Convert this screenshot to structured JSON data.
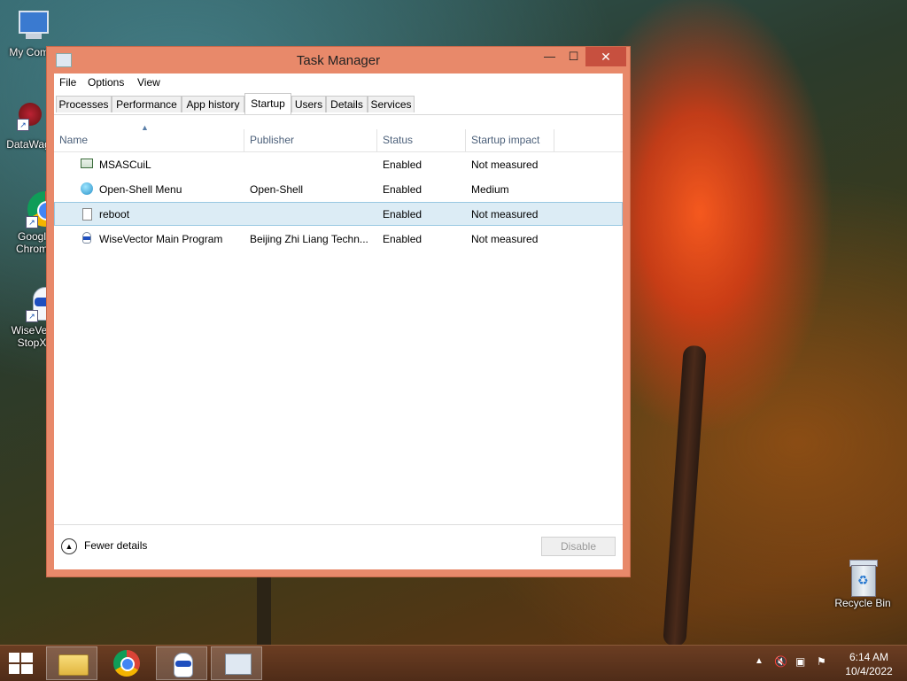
{
  "desktop": {
    "icons": [
      {
        "label": "My Comp",
        "icon": "computer-icon"
      },
      {
        "label": "DataWag",
        "icon": "datawag-icon"
      },
      {
        "label": "Googl",
        "label2": "Chrom",
        "icon": "chrome-icon"
      },
      {
        "label": "WiseVec",
        "label2": "StopX",
        "icon": "wisevector-icon"
      },
      {
        "label": "Recycle Bin",
        "icon": "recycle-bin-icon"
      }
    ]
  },
  "window": {
    "title": "Task Manager",
    "controls": {
      "minimize": "—",
      "maximize": "☐",
      "close": "✕"
    },
    "menu": [
      "File",
      "Options",
      "View"
    ],
    "tabs": [
      "Processes",
      "Performance",
      "App history",
      "Startup",
      "Users",
      "Details",
      "Services"
    ],
    "active_tab": "Startup",
    "columns": [
      "Name",
      "Publisher",
      "Status",
      "Startup impact"
    ],
    "rows": [
      {
        "name": "MSASCuiL",
        "publisher": "",
        "status": "Enabled",
        "impact": "Not measured",
        "icon": "defender-icon"
      },
      {
        "name": "Open-Shell Menu",
        "publisher": "Open-Shell",
        "status": "Enabled",
        "impact": "Medium",
        "icon": "open-shell-icon"
      },
      {
        "name": "reboot",
        "publisher": "",
        "status": "Enabled",
        "impact": "Not measured",
        "icon": "file-icon"
      },
      {
        "name": "WiseVector Main Program",
        "publisher": "Beijing Zhi Liang Techn...",
        "status": "Enabled",
        "impact": "Not measured",
        "icon": "wisevector-icon"
      }
    ],
    "selected_row": "reboot",
    "footer": {
      "fewer_details": "Fewer details",
      "disable": "Disable"
    }
  },
  "taskbar": {
    "items": [
      "start-button",
      "file-explorer",
      "chrome",
      "wisevector",
      "task-manager"
    ],
    "clock": {
      "time": "6:14 AM",
      "date": "10/4/2022"
    }
  },
  "colors": {
    "window_frame": "#e8896a",
    "close_button": "#c7503f",
    "selection": "#dcecf5"
  }
}
